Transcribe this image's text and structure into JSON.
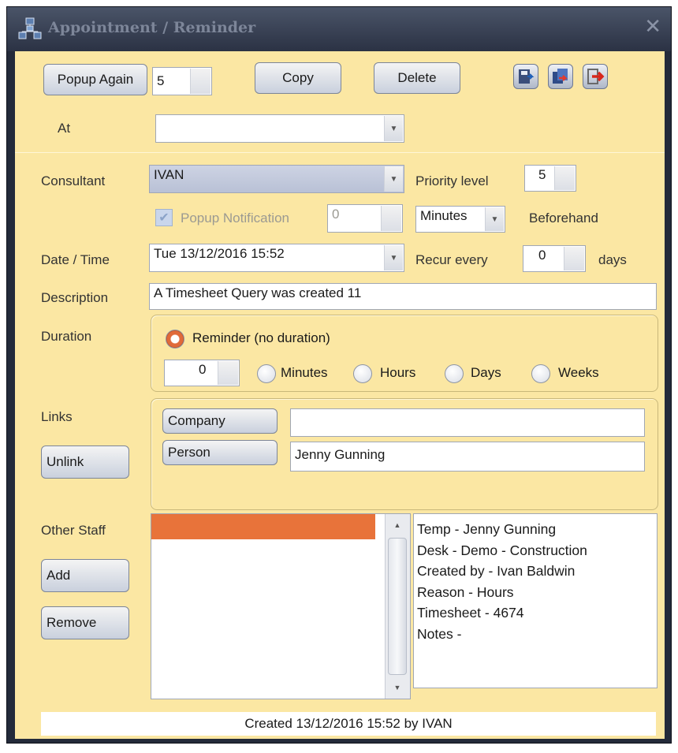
{
  "window": {
    "title": "Appointment / Reminder",
    "app_icon": "organization-chart-icon",
    "close_icon": "✕"
  },
  "toolbar": {
    "popup_again_label": "Popup Again",
    "popup_again_value": "5",
    "copy_label": "Copy",
    "delete_label": "Delete",
    "at_label": "At",
    "at_value": "",
    "icons": [
      "save-icon",
      "copy-record-icon",
      "exit-icon"
    ]
  },
  "form": {
    "consultant_label": "Consultant",
    "consultant_value": "IVAN",
    "priority_label": "Priority level",
    "priority_value": "5",
    "popup_notification_label": "Popup Notification",
    "popup_notification_checked": true,
    "popup_notification_value": "0",
    "unit_value": "Minutes",
    "beforehand_label": "Beforehand",
    "datetime_label": "Date / Time",
    "datetime_value": "Tue 13/12/2016 15:52",
    "recur_label": "Recur every",
    "recur_value": "0",
    "days_label": "days",
    "description_label": "Description",
    "description_value": "A Timesheet Query was created 11"
  },
  "duration": {
    "label": "Duration",
    "reminder_label": "Reminder (no duration)",
    "reminder_selected": true,
    "value": "0",
    "options": [
      "Minutes",
      "Hours",
      "Days",
      "Weeks"
    ]
  },
  "links": {
    "label": "Links",
    "unlink_label": "Unlink",
    "company_label": "Company",
    "company_value": "",
    "person_label": "Person",
    "person_value": "Jenny Gunning"
  },
  "other_staff": {
    "label": "Other Staff",
    "add_label": "Add",
    "remove_label": "Remove",
    "selection_color": "#e8733a",
    "notes": [
      "Temp - Jenny Gunning",
      "Desk - Demo - Construction",
      "Created by - Ivan Baldwin",
      "Reason - Hours",
      "Timesheet - 4674",
      "Notes -"
    ]
  },
  "status": {
    "text": "Created 13/12/2016 15:52 by IVAN"
  }
}
